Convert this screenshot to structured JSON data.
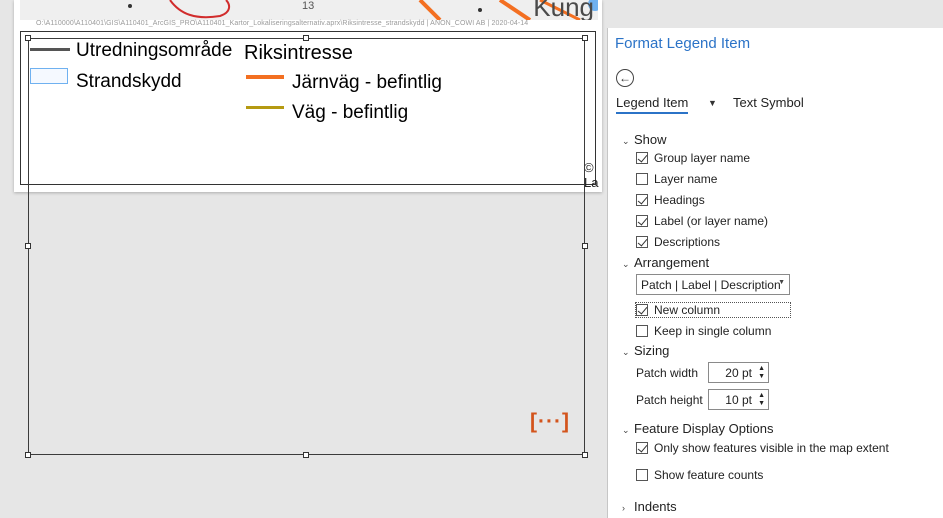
{
  "map": {
    "place_label": "Kung",
    "small_label": "13",
    "path_text": "O:\\A110000\\A110401\\GIS\\A110401_ArcGIS_PRO\\A110401_Kartor_Lokaliseringsalternativ.aprx\\Riksintresse_strandskydd | ANON_COWI AB | 2020-04-14",
    "copyright": "© La"
  },
  "legend": {
    "items_col1": [
      {
        "label": "Utredningsområde",
        "patch": "line",
        "color": "#555555"
      },
      {
        "label": "Strandskydd",
        "patch": "rect",
        "color": "#6fb1f0"
      }
    ],
    "heading_col2": "Riksintresse",
    "items_col2": [
      {
        "label": "Järnväg - befintlig",
        "patch": "line",
        "color": "#f36f21"
      },
      {
        "label": "Väg - befintlig",
        "patch": "line",
        "color": "#b59a11"
      }
    ],
    "overflow_indicator": "[···]"
  },
  "pane": {
    "title": "Format Legend Item",
    "tabs": [
      {
        "label": "Legend Item",
        "active": true
      },
      {
        "label": "Text Symbol",
        "active": false
      }
    ],
    "show": {
      "label": "Show",
      "options": [
        {
          "label": "Group layer name",
          "checked": true
        },
        {
          "label": "Layer name",
          "checked": false
        },
        {
          "label": "Headings",
          "checked": true
        },
        {
          "label": "Label (or layer name)",
          "checked": true
        },
        {
          "label": "Descriptions",
          "checked": true
        }
      ]
    },
    "arrangement": {
      "label": "Arrangement",
      "selected": "Patch | Label | Description",
      "new_column": {
        "label": "New column",
        "checked": true
      },
      "keep_single": {
        "label": "Keep in single column",
        "checked": false
      }
    },
    "sizing": {
      "label": "Sizing",
      "patch_width_label": "Patch width",
      "patch_width_value": "20 pt",
      "patch_height_label": "Patch height",
      "patch_height_value": "10 pt"
    },
    "feature_display": {
      "label": "Feature Display Options",
      "only_visible": {
        "label": "Only show features visible in the map extent",
        "checked": true
      },
      "show_counts": {
        "label": "Show feature counts",
        "checked": false
      }
    },
    "indents": {
      "label": "Indents"
    }
  }
}
